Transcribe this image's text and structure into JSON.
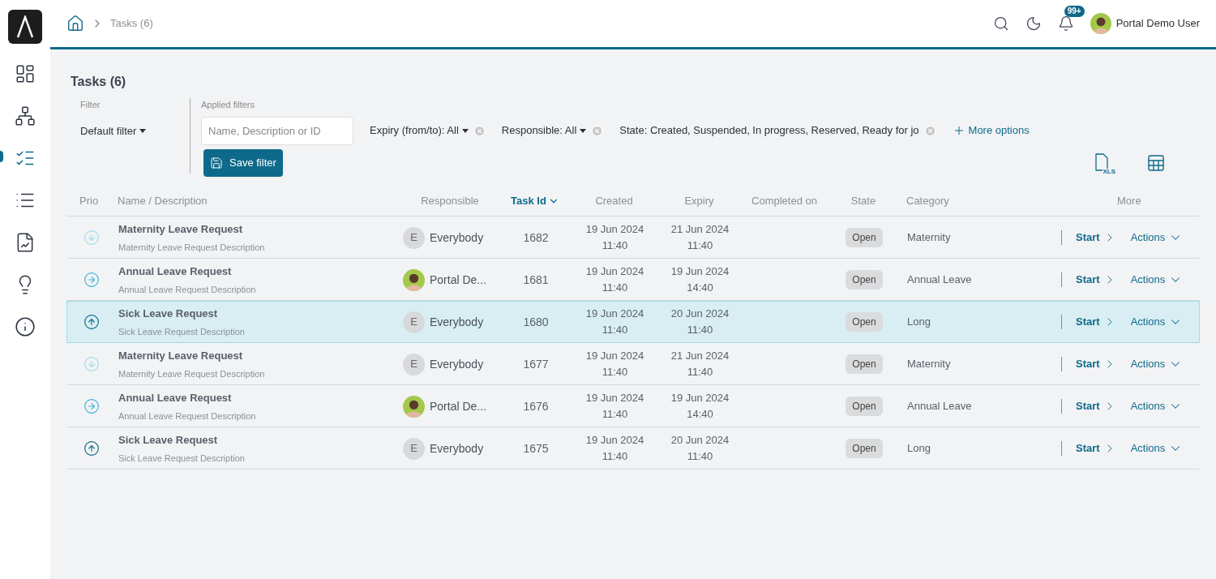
{
  "sidebar": {
    "items": [
      {
        "kind": "dashboard",
        "selected": false
      },
      {
        "kind": "processes",
        "selected": false
      },
      {
        "kind": "tasks",
        "selected": true
      },
      {
        "kind": "list",
        "selected": false
      },
      {
        "kind": "reports",
        "selected": false
      },
      {
        "kind": "ideas",
        "selected": false
      },
      {
        "kind": "info",
        "selected": false
      }
    ]
  },
  "breadcrumb": {
    "current": "Tasks (6)"
  },
  "header": {
    "notifications": "99+",
    "user": "Portal Demo User"
  },
  "page_title": "Tasks (6)",
  "filter": {
    "label": "Filter",
    "value": "Default filter",
    "applied_label": "Applied filters",
    "search_placeholder": "Name, Description or ID",
    "save_button": "Save filter",
    "chips": [
      {
        "text": "Expiry (from/to): All",
        "dropdown": true
      },
      {
        "text": "Responsible: All",
        "dropdown": true
      },
      {
        "text": "State: Created, Suspended, In progress, Reserved, Ready for jo",
        "dropdown": false
      }
    ],
    "more_options": "More options"
  },
  "export_label": "XLS",
  "table": {
    "columns": [
      {
        "label": "Prio",
        "sorted": false
      },
      {
        "label": "Name / Description",
        "sorted": false
      },
      {
        "label": "Responsible",
        "sorted": false
      },
      {
        "label": "Task Id",
        "sorted": true
      },
      {
        "label": "Created",
        "sorted": false
      },
      {
        "label": "Expiry",
        "sorted": false
      },
      {
        "label": "Completed on",
        "sorted": false
      },
      {
        "label": "State",
        "sorted": false
      },
      {
        "label": "Category",
        "sorted": false
      },
      {
        "label": "More",
        "sorted": false
      }
    ],
    "rows": [
      {
        "prio": {
          "kind": "low"
        },
        "name": "Maternity Leave Request",
        "description": "Maternity Leave Request Description",
        "responsible": {
          "kind": "letter",
          "initial": "E",
          "name": "Everybody"
        },
        "id": "1682",
        "created": [
          "19 Jun 2024",
          "11:40"
        ],
        "expiry": [
          "21 Jun 2024",
          "11:40"
        ],
        "state": "Open",
        "category": "Maternity",
        "start": "Start",
        "actions": "Actions",
        "selected": false
      },
      {
        "prio": {
          "kind": "normal"
        },
        "name": "Annual Leave Request",
        "description": "Annual Leave Request Description",
        "responsible": {
          "kind": "user",
          "name": "Portal De..."
        },
        "id": "1681",
        "created": [
          "19 Jun 2024",
          "11:40"
        ],
        "expiry": [
          "19 Jun 2024",
          "14:40"
        ],
        "state": "Open",
        "category": "Annual Leave",
        "start": "Start",
        "actions": "Actions",
        "selected": false
      },
      {
        "prio": {
          "kind": "high"
        },
        "name": "Sick Leave Request",
        "description": "Sick Leave Request Description",
        "responsible": {
          "kind": "letter",
          "initial": "E",
          "name": "Everybody"
        },
        "id": "1680",
        "created": [
          "19 Jun 2024",
          "11:40"
        ],
        "expiry": [
          "20 Jun 2024",
          "11:40"
        ],
        "state": "Open",
        "category": "Long",
        "start": "Start",
        "actions": "Actions",
        "selected": true
      },
      {
        "prio": {
          "kind": "low"
        },
        "name": "Maternity Leave Request",
        "description": "Maternity Leave Request Description",
        "responsible": {
          "kind": "letter",
          "initial": "E",
          "name": "Everybody"
        },
        "id": "1677",
        "created": [
          "19 Jun 2024",
          "11:40"
        ],
        "expiry": [
          "21 Jun 2024",
          "11:40"
        ],
        "state": "Open",
        "category": "Maternity",
        "start": "Start",
        "actions": "Actions",
        "selected": false
      },
      {
        "prio": {
          "kind": "normal"
        },
        "name": "Annual Leave Request",
        "description": "Annual Leave Request Description",
        "responsible": {
          "kind": "user",
          "name": "Portal De..."
        },
        "id": "1676",
        "created": [
          "19 Jun 2024",
          "11:40"
        ],
        "expiry": [
          "19 Jun 2024",
          "14:40"
        ],
        "state": "Open",
        "category": "Annual Leave",
        "start": "Start",
        "actions": "Actions",
        "selected": false
      },
      {
        "prio": {
          "kind": "high"
        },
        "name": "Sick Leave Request",
        "description": "Sick Leave Request Description",
        "responsible": {
          "kind": "letter",
          "initial": "E",
          "name": "Everybody"
        },
        "id": "1675",
        "created": [
          "19 Jun 2024",
          "11:40"
        ],
        "expiry": [
          "20 Jun 2024",
          "11:40"
        ],
        "state": "Open",
        "category": "Long",
        "start": "Start",
        "actions": "Actions",
        "selected": false
      }
    ]
  }
}
